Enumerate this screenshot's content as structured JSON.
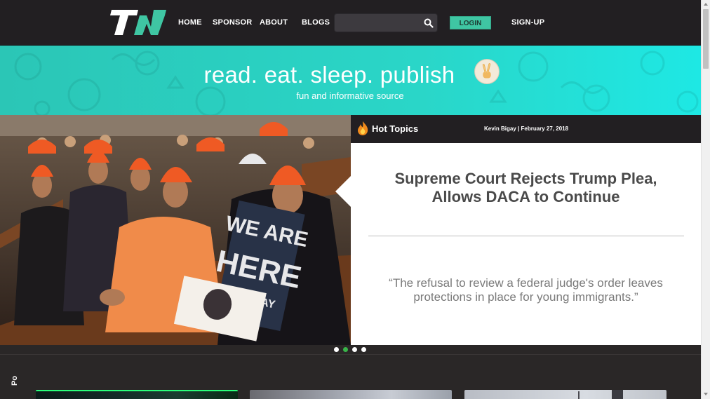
{
  "header": {
    "logo_text": "TN",
    "nav": {
      "home": "HOME",
      "sponsor": "SPONSOR",
      "about": "ABOUT",
      "blogs": "BLOGS"
    },
    "search": {
      "value": "",
      "placeholder": ""
    },
    "login": "LOGIN",
    "signup": "SIGN-UP"
  },
  "banner": {
    "tagline": "read. eat. sleep. publish",
    "subtagline": "fun and informative source"
  },
  "hero": {
    "photo_sign_text": "WE ARE HERE TO STAY",
    "topic_label": "Hot Topics",
    "byline": "Kevin Bigay | February 27, 2018",
    "headline_line1": "Supreme Court Rejects Trump Plea,",
    "headline_line2": "Allows DACA to Continue",
    "quote_line1": "“The refusal to review a federal judge's order leaves",
    "quote_line2": "protections in place for young immigrants.”",
    "slides": {
      "count": 4,
      "active": 2
    }
  },
  "lower": {
    "side_text": "Po"
  },
  "colors": {
    "header_bg": "#221f22",
    "accent": "#3fc6a3",
    "banner_teal": "#2ad6c8",
    "active_dot": "#39b54a",
    "beanie_orange": "#ef5a24"
  },
  "icons": [
    "tn-logo",
    "search-icon",
    "peace-hand-icon",
    "flame-icon"
  ]
}
